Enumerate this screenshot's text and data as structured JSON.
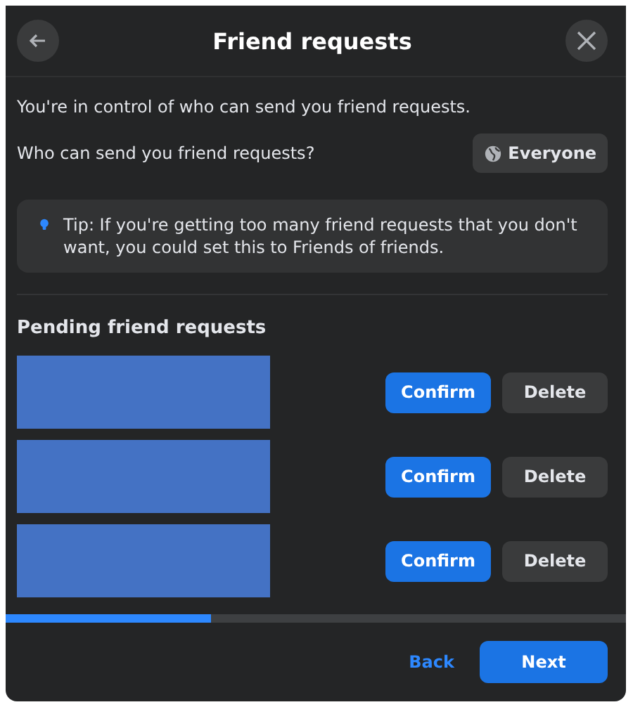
{
  "dialog": {
    "title": "Friend requests"
  },
  "intro": "You're in control of who can send you friend requests.",
  "audience": {
    "question": "Who can send you friend requests?",
    "value": "Everyone"
  },
  "tip": "Tip: If you're getting too many friend requests that you don't want, you could set this to Friends of friends.",
  "pending": {
    "heading": "Pending friend requests",
    "requests": [
      {
        "confirm": "Confirm",
        "delete": "Delete"
      },
      {
        "confirm": "Confirm",
        "delete": "Delete"
      },
      {
        "confirm": "Confirm",
        "delete": "Delete"
      }
    ]
  },
  "progress": {
    "level": 0.33
  },
  "footer": {
    "back": "Back",
    "next": "Next"
  }
}
